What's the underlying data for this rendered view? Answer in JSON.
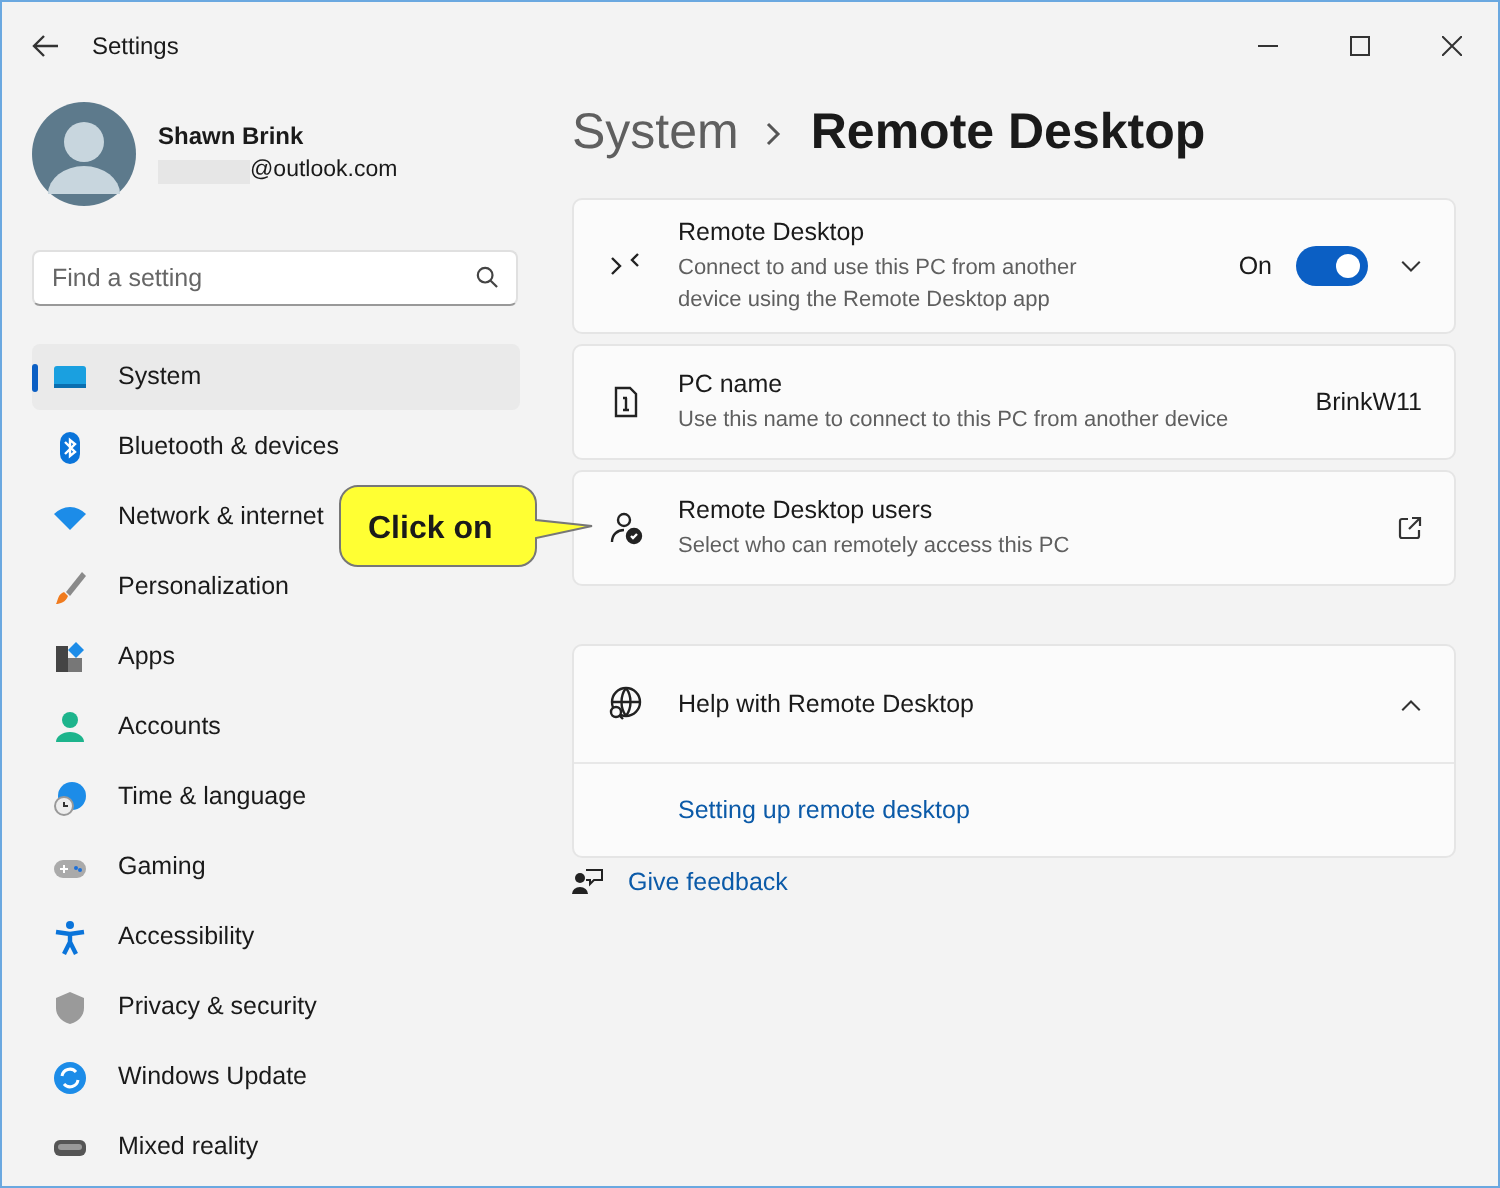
{
  "window": {
    "title": "Settings"
  },
  "user": {
    "name": "Shawn Brink",
    "email": "@outlook.com"
  },
  "search": {
    "placeholder": "Find a setting"
  },
  "nav": [
    {
      "label": "System",
      "selected": true
    },
    {
      "label": "Bluetooth & devices",
      "selected": false
    },
    {
      "label": "Network & internet",
      "selected": false
    },
    {
      "label": "Personalization",
      "selected": false
    },
    {
      "label": "Apps",
      "selected": false
    },
    {
      "label": "Accounts",
      "selected": false
    },
    {
      "label": "Time & language",
      "selected": false
    },
    {
      "label": "Gaming",
      "selected": false
    },
    {
      "label": "Accessibility",
      "selected": false
    },
    {
      "label": "Privacy & security",
      "selected": false
    },
    {
      "label": "Windows Update",
      "selected": false
    },
    {
      "label": "Mixed reality",
      "selected": false
    }
  ],
  "breadcrumb": {
    "parent": "System",
    "current": "Remote Desktop"
  },
  "settings": [
    {
      "kind": "toggle",
      "title": "Remote Desktop",
      "description": "Connect to and use this PC from another device using the Remote Desktop app",
      "state_label": "On",
      "on": true,
      "expanded": false
    },
    {
      "kind": "value",
      "title": "PC name",
      "description": "Use this name to connect to this PC from another device",
      "value": "BrinkW11"
    },
    {
      "kind": "link",
      "title": "Remote Desktop users",
      "description": "Select who can remotely access this PC"
    }
  ],
  "help": {
    "title": "Help with Remote Desktop",
    "expanded": true,
    "links": [
      "Setting up remote desktop"
    ]
  },
  "feedback": "Give feedback",
  "callout": "Click on"
}
